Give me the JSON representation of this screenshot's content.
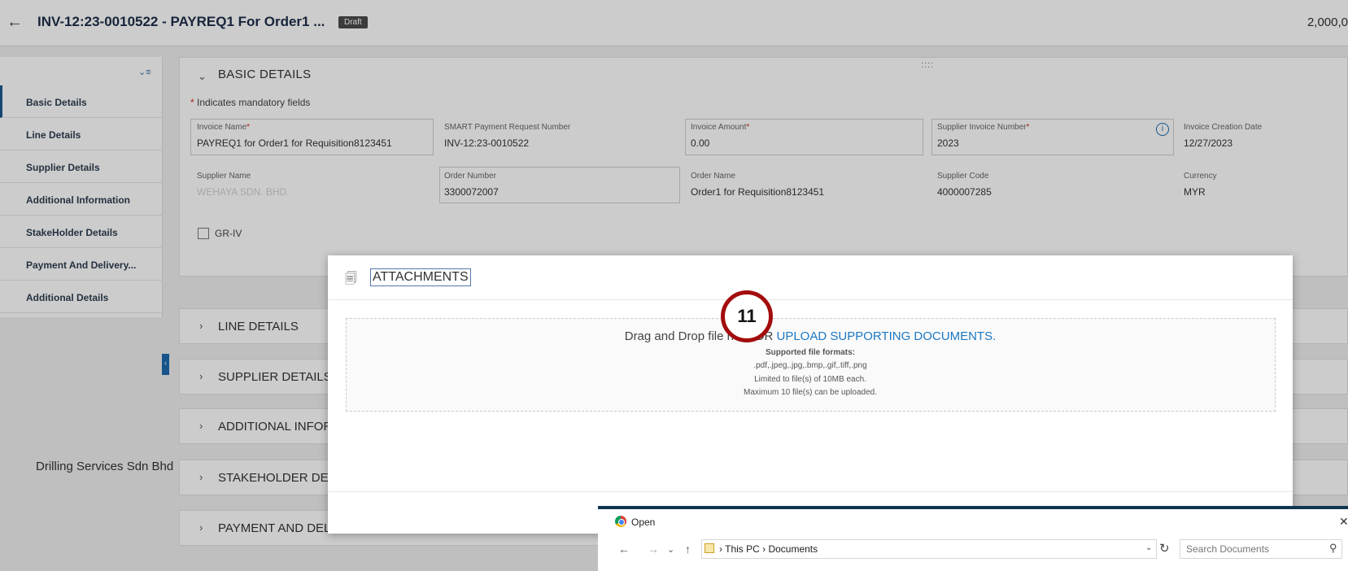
{
  "header": {
    "back_glyph": "←",
    "title": "INV-12:23-0010522 - PAYREQ1 For Order1 ...",
    "status_badge": "Draft",
    "amount": "2,000,0"
  },
  "sidebar": {
    "collapse_glyph": "⌄≡",
    "items": [
      {
        "label": "Basic Details"
      },
      {
        "label": "Line Details"
      },
      {
        "label": "Supplier Details"
      },
      {
        "label": "Additional Information"
      },
      {
        "label": "StakeHolder Details"
      },
      {
        "label": "Payment And Delivery..."
      },
      {
        "label": "Additional Details"
      }
    ],
    "toggle_glyph": "‹",
    "company": "Drilling Services Sdn Bhd"
  },
  "basic": {
    "chevron": "⌄",
    "title": "BASIC DETAILS",
    "drag_handle": "::::",
    "mandatory_star": "*",
    "mandatory_note": " Indicates mandatory fields",
    "fields": [
      {
        "label": "Invoice Name",
        "required": "*",
        "value": "PAYREQ1 for Order1 for Requisition8123451"
      },
      {
        "label": "SMART Payment Request Number",
        "value": "INV-12:23-0010522"
      },
      {
        "label": "Invoice Amount",
        "required": "*",
        "value": "0.00"
      },
      {
        "label": "Supplier Invoice Number",
        "required": "*",
        "value": "2023"
      },
      {
        "label": "Invoice Creation Date",
        "value": "12/27/2023"
      },
      {
        "label": "Supplier Name",
        "value": "WEHAYA SDN. BHD."
      },
      {
        "label": "Order Number",
        "value": "3300072007"
      },
      {
        "label": "Order Name",
        "value": "Order1 for Requisition8123451"
      },
      {
        "label": "Supplier Code",
        "value": "4000007285"
      },
      {
        "label": "Currency",
        "value": "MYR"
      }
    ],
    "info_glyph": "i",
    "checkbox_label": "GR-IV"
  },
  "sections": [
    {
      "chevron": "›",
      "title": "LINE DETAILS"
    },
    {
      "chevron": "›",
      "title": "SUPPLIER DETAILS"
    },
    {
      "chevron": "›",
      "title": "ADDITIONAL INFORMATION"
    },
    {
      "chevron": "›",
      "title": "STAKEHOLDER DETAILS"
    },
    {
      "chevron": "›",
      "title": "PAYMENT AND DELIVERY"
    }
  ],
  "attachments": {
    "icon_glyph": "🗐",
    "title": "ATTACHMENTS",
    "drop_text": "Drag and Drop file here OR ",
    "upload_link": "UPLOAD SUPPORTING DOCUMENTS.",
    "formats_title": "Supported file formats:",
    "formats": ".pdf,.jpeg,.jpg,.bmp,.gif,.tiff,.png",
    "size_limit": "Limited to file(s) of 10MB each.",
    "max_files": "Maximum 10 file(s) can be uploaded."
  },
  "step_number": "11",
  "open_dialog": {
    "title": "Open",
    "close_glyph": "✕",
    "back_glyph": "←",
    "forward_glyph": "→",
    "recent_glyph": "⌄",
    "up_glyph": "↑",
    "breadcrumb": "› This PC › Documents",
    "dropdown_glyph": "⌄",
    "refresh_glyph": "↻",
    "search_placeholder": "Search Documents",
    "search_glyph": "⚲"
  }
}
